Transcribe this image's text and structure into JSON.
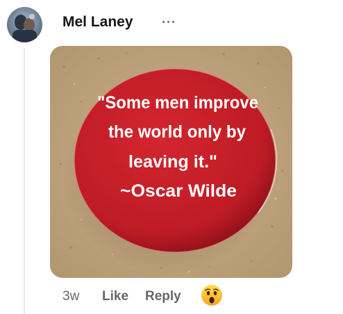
{
  "comment": {
    "author_name": "Mel Laney",
    "options_icon": "more-horizontal-icon",
    "image": {
      "quote_lines": [
        "\"Some men improve",
        "the world only by",
        "leaving it.\"",
        "~Oscar Wilde"
      ],
      "button_color": "#c8202a",
      "background_color": "#bfa57d"
    },
    "timestamp": "3w",
    "like_label": "Like",
    "reply_label": "Reply",
    "reaction_icon": "wow-emoji-icon"
  },
  "colors": {
    "meta_text": "#65676b",
    "author_text": "#151515",
    "thread_line": "#e6e7ea"
  }
}
